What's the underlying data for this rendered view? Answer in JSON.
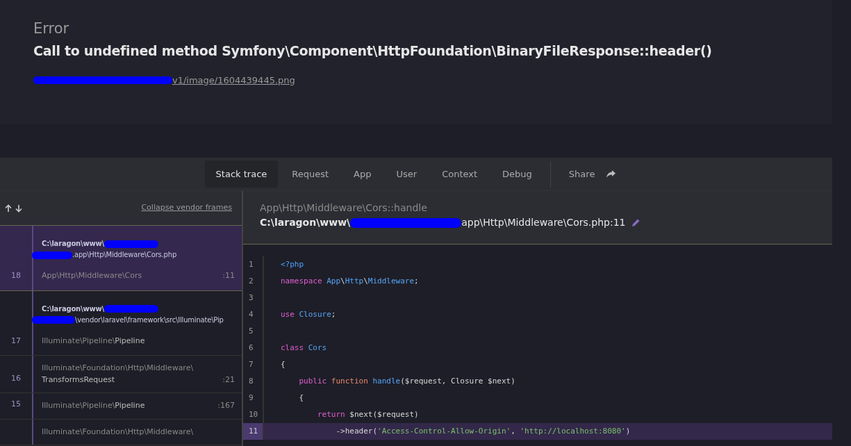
{
  "error": {
    "label": "Error",
    "message": "Call to undefined method Symfony\\Component\\HttpFoundation\\BinaryFileResponse::header()",
    "url": "v1/image/1604439445.png"
  },
  "tabs": [
    {
      "label": "Stack trace",
      "selected": true
    },
    {
      "label": "Request",
      "selected": false
    },
    {
      "label": "App",
      "selected": false
    },
    {
      "label": "User",
      "selected": false
    },
    {
      "label": "Context",
      "selected": false
    },
    {
      "label": "Debug",
      "selected": false
    }
  ],
  "share": {
    "label": "Share"
  },
  "frames_panel": {
    "collapse_link": "Collapse vendor frames"
  },
  "frames": [
    {
      "number": "18",
      "path_start": "C:\\laragon\\www\\",
      "path_end": ".app\\Http\\Middleware\\Cors.php",
      "class": "App\\Http\\Middleware\\Cors",
      "line": ":11",
      "selected": true
    },
    {
      "number": "17",
      "path_start": "C:\\laragon\\www\\",
      "path_end": "\\vendor\\laravel\\framework\\src\\Illuminate\\Pip",
      "class": "Illuminate\\Pipeline\\**Pipeline**",
      "selected": false
    },
    {
      "number": "16",
      "class": "Illuminate\\Foundation\\Http\\Middleware\\",
      "class_2": "**TransformsRequest**",
      "line": ":21",
      "selected": false
    },
    {
      "number": "15",
      "class": "Illuminate\\Pipeline\\**Pipeline**",
      "line": ":167",
      "selected": false
    },
    {
      "class": "Illuminate\\Foundation\\Http\\Middleware\\",
      "selected": false
    }
  ],
  "source": {
    "method": "App\\Http\\Middleware\\Cors::handle",
    "path_start": "C:\\laragon\\www\\",
    "path_end": "app\\Http\\Middleware\\Cors.php:11"
  },
  "code_lines": [
    {
      "number": "1",
      "highlighted": false,
      "tokens": [
        {
          "kind": "tag",
          "text": "<?php"
        }
      ]
    },
    {
      "number": "2",
      "highlighted": false,
      "tokens": [
        {
          "kind": "keyword",
          "text": "namespace "
        },
        {
          "kind": "type",
          "text": "App"
        },
        {
          "kind": "plain",
          "text": "\\"
        },
        {
          "kind": "type",
          "text": "Http"
        },
        {
          "kind": "plain",
          "text": "\\"
        },
        {
          "kind": "type",
          "text": "Middleware"
        },
        {
          "kind": "plain",
          "text": ";"
        }
      ]
    },
    {
      "number": "3",
      "highlighted": false
    },
    {
      "number": "4",
      "highlighted": false,
      "tokens": [
        {
          "kind": "keyword",
          "text": "use "
        },
        {
          "kind": "type",
          "text": "Closure"
        },
        {
          "kind": "plain",
          "text": ";"
        }
      ]
    },
    {
      "number": "5",
      "highlighted": false
    },
    {
      "number": "6",
      "highlighted": false,
      "tokens": [
        {
          "kind": "keyword",
          "text": "class "
        },
        {
          "kind": "type",
          "text": "Cors"
        }
      ]
    },
    {
      "number": "7",
      "highlighted": false,
      "tokens": [
        {
          "kind": "plain",
          "text": "{"
        }
      ]
    },
    {
      "number": "8",
      "highlighted": false,
      "tokens": [
        {
          "kind": "keyword",
          "text": "    public "
        },
        {
          "kind": "function",
          "text": "function "
        },
        {
          "kind": "type",
          "text": "handle"
        },
        {
          "kind": "plain",
          "text": "($request, Closure $next)"
        }
      ]
    },
    {
      "number": "9",
      "highlighted": false,
      "tokens": [
        {
          "kind": "plain",
          "text": "    {"
        }
      ]
    },
    {
      "number": "10",
      "highlighted": false,
      "tokens": [
        {
          "kind": "keyword",
          "text": "        return "
        },
        {
          "kind": "plain",
          "text": "$next($request)"
        }
      ]
    },
    {
      "number": "11",
      "highlighted": true,
      "tokens": [
        {
          "kind": "plain",
          "text": "            ->header("
        },
        {
          "kind": "string",
          "text": "'Access-Control-Allow-Origin'"
        },
        {
          "kind": "plain",
          "text": ", "
        },
        {
          "kind": "string",
          "text": "'http://localhost:8080'"
        },
        {
          "kind": "plain",
          "text": ")"
        }
      ]
    }
  ]
}
